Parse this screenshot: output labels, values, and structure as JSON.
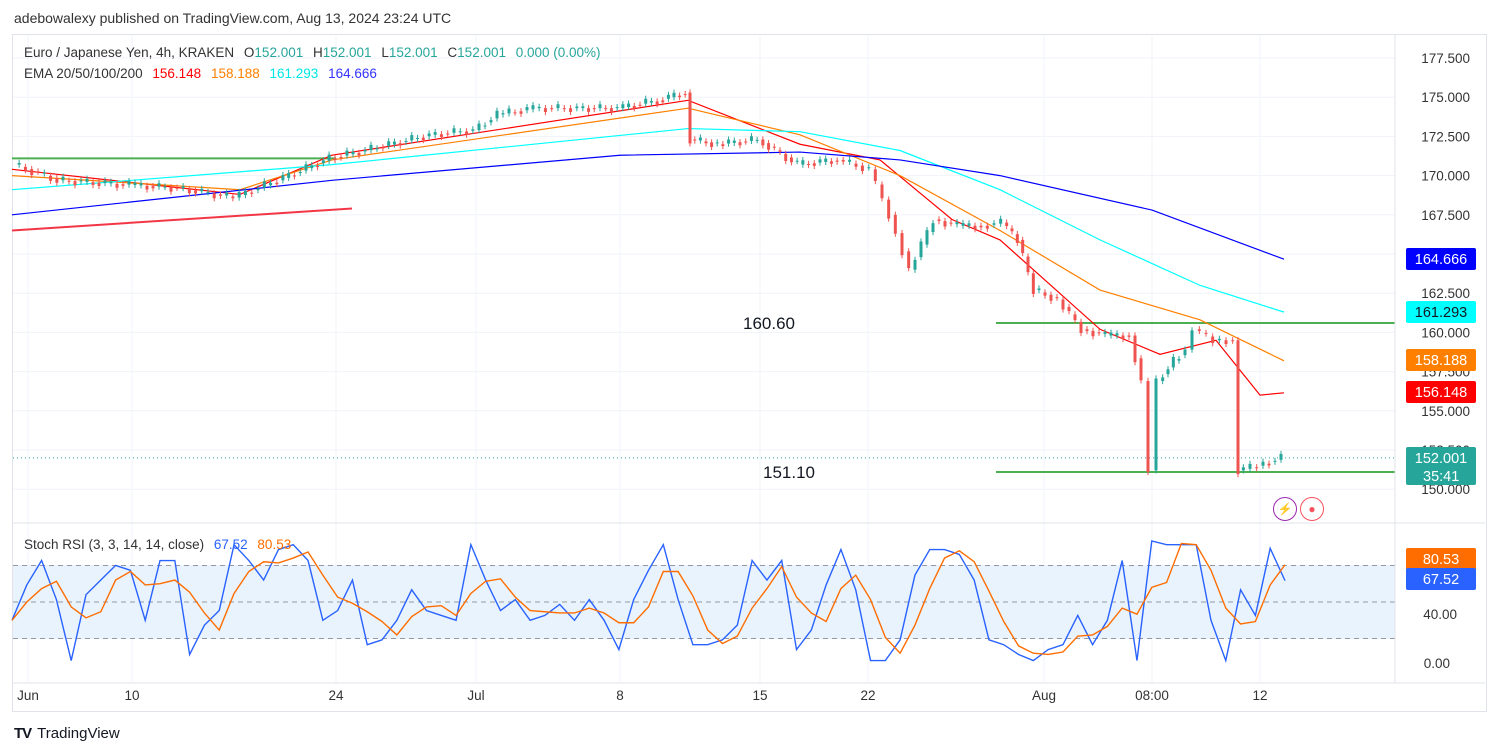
{
  "header": {
    "published": "adebowalexy published on TradingView.com, Aug 13, 2024 23:24 UTC"
  },
  "legend": {
    "symbol": "Euro / Japanese Yen, 4h, KRAKEN",
    "o_label": "O",
    "o": "152.001",
    "h_label": "H",
    "h": "152.001",
    "l_label": "L",
    "l": "152.001",
    "c_label": "C",
    "c": "152.001",
    "change": "0.000 (0.00%)",
    "ema_label": "EMA 20/50/100/200",
    "ema20": "156.148",
    "ema50": "158.188",
    "ema100": "161.293",
    "ema200": "164.666"
  },
  "rsi_legend": {
    "label": "Stoch RSI (3, 3, 14, 14, close)",
    "k": "67.52",
    "d": "80.53"
  },
  "badges": {
    "ema200": "164.666",
    "ema100": "161.293",
    "ema50": "158.188",
    "ema20": "156.148",
    "price": "152.001",
    "countdown": "35:41",
    "rsi_d": "80.53",
    "rsi_k": "67.52"
  },
  "colors": {
    "up": "#26a69a",
    "down": "#ef5350",
    "ema20": "#ff0000",
    "ema50": "#ff7f00",
    "ema100": "#00ffff",
    "ema200": "#0000ff",
    "level": "#4caf50",
    "trend": "#f23645",
    "rsi_k": "#2962ff",
    "rsi_d": "#ff6d00"
  },
  "footer": {
    "brand": "TradingView"
  },
  "chart_data": [
    {
      "type": "line",
      "title": "Euro / Japanese Yen, 4h, KRAKEN",
      "x_unit": "4h bar index",
      "ylim": [
        148.8,
        178.9
      ],
      "y_ticks": [
        "177.500",
        "175.000",
        "172.500",
        "170.000",
        "167.500",
        "165.000",
        "162.500",
        "160.000",
        "157.500",
        "155.000",
        "152.500",
        "150.000"
      ],
      "x_ticks": [
        {
          "label": "Jun",
          "bar": 4
        },
        {
          "label": "10",
          "bar": 30
        },
        {
          "label": "24",
          "bar": 81
        },
        {
          "label": "Jul",
          "bar": 116
        },
        {
          "label": "8",
          "bar": 152
        },
        {
          "label": "15",
          "bar": 187
        },
        {
          "label": "22",
          "bar": 214
        },
        {
          "label": "Aug",
          "bar": 258
        },
        {
          "label": "08:00",
          "bar": 285
        },
        {
          "label": "12",
          "bar": 312
        }
      ],
      "close": [
        [
          1,
          170.7
        ],
        [
          12,
          169.7
        ],
        [
          30,
          169.4
        ],
        [
          42,
          169.2
        ],
        [
          56,
          168.6
        ],
        [
          67,
          169.7
        ],
        [
          80,
          171.1
        ],
        [
          92,
          171.8
        ],
        [
          105,
          172.6
        ],
        [
          116,
          172.9
        ],
        [
          122,
          173.9
        ],
        [
          131,
          174.3
        ],
        [
          142,
          174.3
        ],
        [
          152,
          174.3
        ],
        [
          162,
          174.8
        ],
        [
          169,
          175.3
        ],
        [
          170,
          172.3
        ],
        [
          177,
          172.0
        ],
        [
          187,
          172.3
        ],
        [
          197,
          170.7
        ],
        [
          207,
          171.0
        ],
        [
          215,
          170.4
        ],
        [
          220,
          167.5
        ],
        [
          225,
          164.0
        ],
        [
          231,
          167.2
        ],
        [
          237,
          166.8
        ],
        [
          243,
          166.8
        ],
        [
          248,
          167.0
        ],
        [
          252,
          165.9
        ],
        [
          256,
          162.7
        ],
        [
          262,
          162.1
        ],
        [
          268,
          160.2
        ],
        [
          274,
          159.8
        ],
        [
          280,
          159.8
        ],
        [
          283,
          156.9
        ],
        [
          285,
          151.2
        ],
        [
          287,
          156.9
        ],
        [
          291,
          158.2
        ],
        [
          294,
          158.9
        ],
        [
          296,
          160.2
        ],
        [
          301,
          159.5
        ],
        [
          306,
          159.5
        ],
        [
          307,
          151.2
        ],
        [
          312,
          151.5
        ],
        [
          318,
          152.0
        ]
      ],
      "series": [
        {
          "name": "EMA 20",
          "color_key": "ema20",
          "points": [
            [
              0,
              170.4
            ],
            [
              57,
              168.8
            ],
            [
              80,
              171.3
            ],
            [
              169,
              174.8
            ],
            [
              197,
              172.0
            ],
            [
              217,
              171.0
            ],
            [
              235,
              167.2
            ],
            [
              247,
              165.9
            ],
            [
              272,
              160.2
            ],
            [
              287,
              158.6
            ],
            [
              301,
              159.5
            ],
            [
              312,
              156.0
            ],
            [
              318,
              156.148
            ]
          ]
        },
        {
          "name": "EMA 50",
          "color_key": "ema50",
          "points": [
            [
              0,
              170.0
            ],
            [
              57,
              169.1
            ],
            [
              80,
              171.0
            ],
            [
              169,
              174.3
            ],
            [
              197,
              172.6
            ],
            [
              222,
              170.0
            ],
            [
              247,
              166.5
            ],
            [
              272,
              162.7
            ],
            [
              297,
              160.8
            ],
            [
              318,
              158.188
            ]
          ]
        },
        {
          "name": "EMA 100",
          "color_key": "ema100",
          "points": [
            [
              0,
              169.1
            ],
            [
              80,
              170.7
            ],
            [
              169,
              173.0
            ],
            [
              197,
              172.8
            ],
            [
              222,
              171.6
            ],
            [
              247,
              169.1
            ],
            [
              272,
              165.9
            ],
            [
              297,
              163.0
            ],
            [
              318,
              161.293
            ]
          ]
        },
        {
          "name": "EMA 200",
          "color_key": "ema200",
          "points": [
            [
              0,
              167.5
            ],
            [
              80,
              169.7
            ],
            [
              152,
              171.3
            ],
            [
              197,
              171.5
            ],
            [
              222,
              171.0
            ],
            [
              247,
              170.0
            ],
            [
              285,
              167.8
            ],
            [
              318,
              164.666
            ]
          ]
        }
      ],
      "levels": [
        {
          "label": "",
          "value": 171.1,
          "from_bar": 0,
          "to_bar": 81,
          "color_key": "level"
        },
        {
          "label": "160.60",
          "value": 160.6,
          "from_bar": 246,
          "to_bar": 346,
          "color_key": "level"
        },
        {
          "label": "151.10",
          "value": 151.1,
          "from_bar": 246,
          "to_bar": 346,
          "color_key": "level"
        }
      ],
      "trendline": {
        "from": [
          0,
          166.5
        ],
        "to": [
          85,
          167.9
        ]
      },
      "current_price": 152.001
    },
    {
      "type": "line",
      "title": "Stoch RSI (3, 3, 14, 14, close)",
      "ylim": [
        -5,
        105
      ],
      "y_ticks": [
        "40.00",
        "0.00"
      ],
      "bands": [
        20,
        50,
        80
      ],
      "series": [
        {
          "name": "K",
          "color_key": "rsi_k",
          "values": [
            35,
            64,
            84,
            52,
            2,
            56,
            68,
            80,
            76,
            35,
            84,
            84,
            7,
            31,
            43,
            97,
            84,
            68,
            93,
            97,
            84,
            35,
            43,
            68,
            15,
            19,
            35,
            60,
            43,
            39,
            35,
            97,
            68,
            43,
            52,
            35,
            39,
            48,
            35,
            52,
            35,
            11,
            52,
            76,
            97,
            52,
            15,
            15,
            19,
            31,
            84,
            68,
            84,
            11,
            27,
            64,
            93,
            60,
            2,
            2,
            19,
            72,
            93,
            93,
            89,
            68,
            19,
            15,
            7,
            2,
            11,
            15,
            39,
            15,
            35,
            84,
            2,
            100,
            97,
            97,
            97,
            35,
            2,
            60,
            39,
            94,
            67.52
          ]
        },
        {
          "name": "D",
          "color_key": "rsi_d",
          "values": [
            35,
            50,
            61,
            67,
            46,
            37,
            42,
            68,
            75,
            64,
            65,
            68,
            58,
            41,
            27,
            57,
            75,
            83,
            82,
            86,
            91,
            72,
            54,
            49,
            42,
            34,
            23,
            38,
            46,
            47,
            39,
            57,
            67,
            69,
            54,
            43,
            42,
            41,
            41,
            45,
            41,
            33,
            33,
            46,
            75,
            75,
            55,
            27,
            16,
            22,
            45,
            61,
            79,
            54,
            41,
            34,
            61,
            72,
            52,
            21,
            8,
            31,
            61,
            86,
            92,
            83,
            59,
            34,
            14,
            8,
            7,
            9,
            22,
            23,
            30,
            45,
            40,
            62,
            66,
            98,
            97,
            76,
            45,
            32,
            34,
            64,
            80.53
          ]
        }
      ]
    }
  ]
}
